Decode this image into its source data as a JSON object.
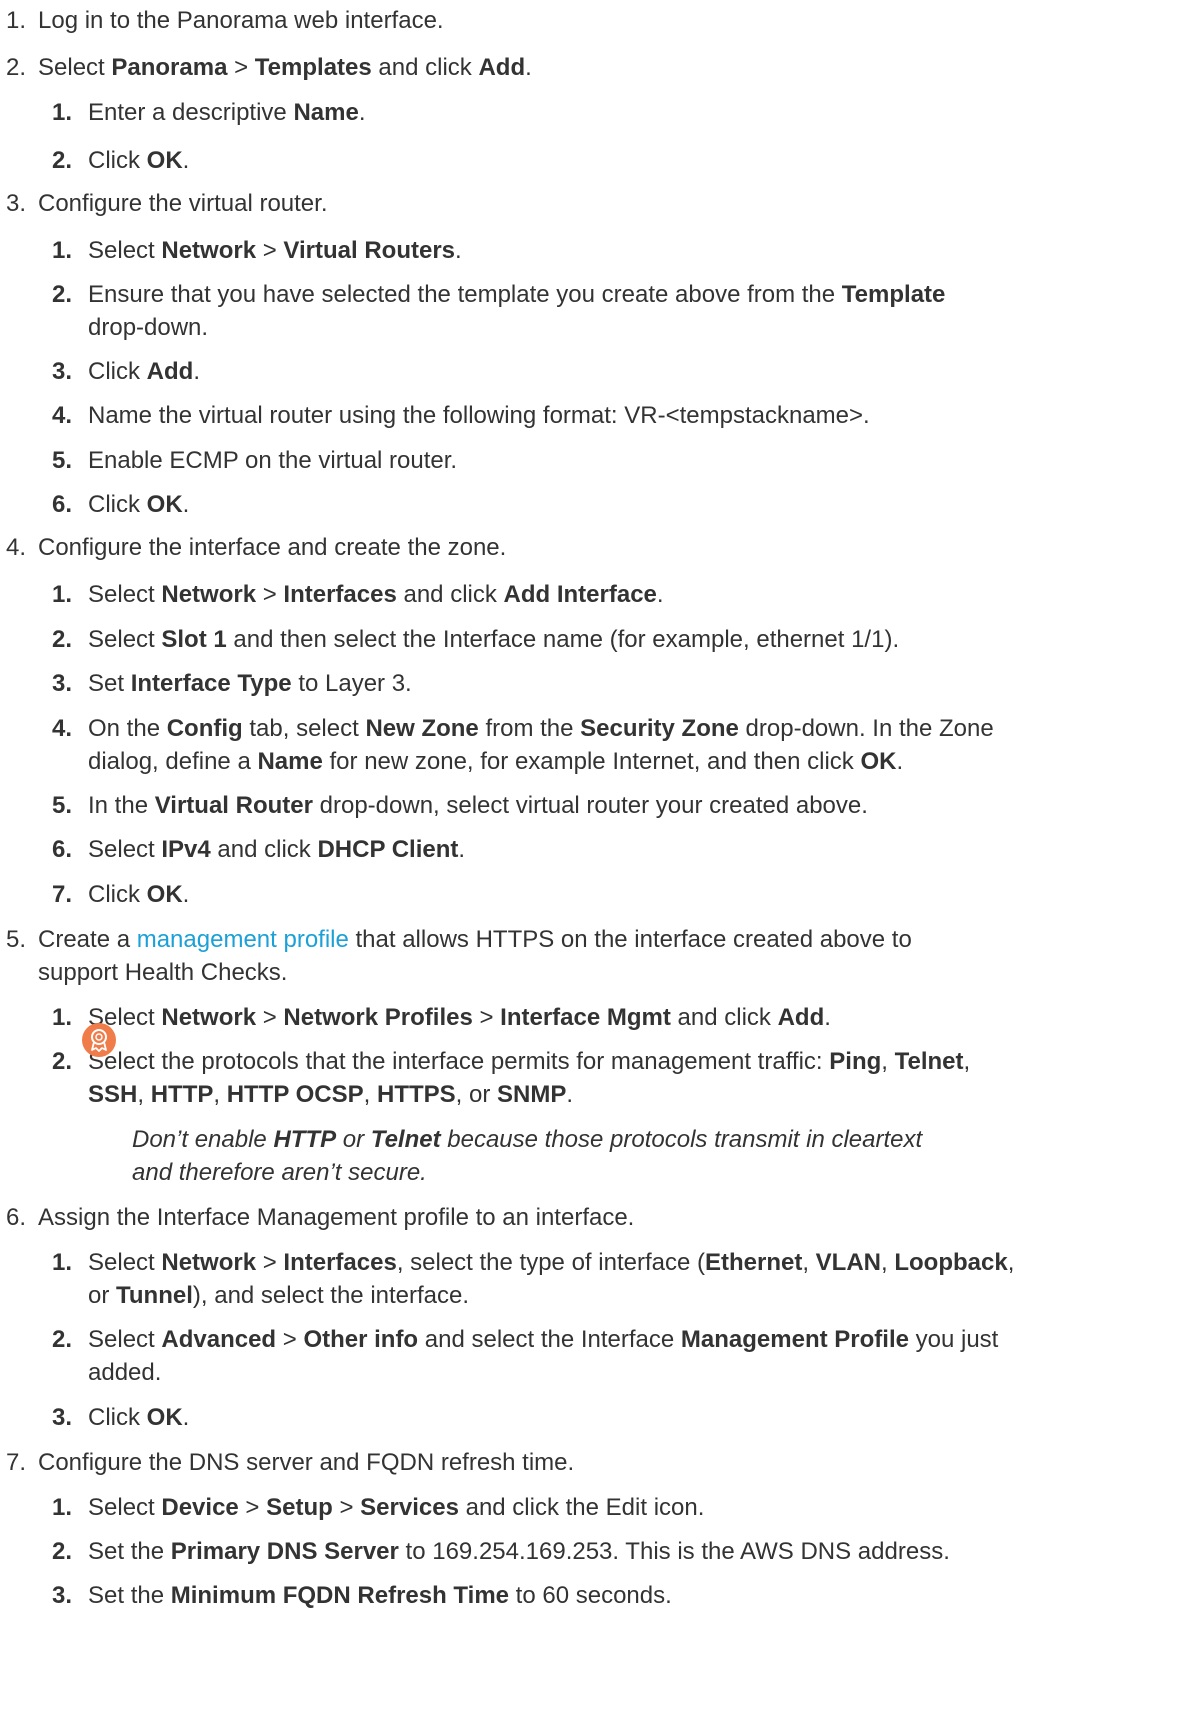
{
  "steps": [
    {
      "num": "1.",
      "lines": [
        [
          "Log in to the Panorama web interface."
        ]
      ],
      "subs": []
    },
    {
      "num": "2.",
      "lines": [
        [
          "Select ",
          {
            "b": "Panorama"
          },
          " > ",
          {
            "b": "Templates"
          },
          " and click ",
          {
            "b": "Add"
          },
          "."
        ]
      ],
      "subs": [
        {
          "num": "1.",
          "lines": [
            [
              "Enter a descriptive ",
              {
                "b": "Name"
              },
              "."
            ]
          ]
        },
        {
          "num": "2.",
          "lines": [
            [
              "Click ",
              {
                "b": "OK"
              },
              "."
            ]
          ]
        }
      ]
    },
    {
      "num": "3.",
      "lines": [
        [
          "Configure the virtual router."
        ]
      ],
      "subs": [
        {
          "num": "1.",
          "lines": [
            [
              "Select ",
              {
                "b": "Network"
              },
              " > ",
              {
                "b": "Virtual Routers"
              },
              "."
            ]
          ]
        },
        {
          "num": "2.",
          "lines": [
            [
              "Ensure that you have selected the template you create above from the ",
              {
                "b": "Template"
              }
            ],
            [
              "drop-down."
            ]
          ]
        },
        {
          "num": "3.",
          "lines": [
            [
              "Click ",
              {
                "b": "Add"
              },
              "."
            ]
          ]
        },
        {
          "num": "4.",
          "lines": [
            [
              "Name the virtual router using the following format: VR-<tempstackname>."
            ]
          ]
        },
        {
          "num": "5.",
          "lines": [
            [
              "Enable ECMP on the virtual router."
            ]
          ]
        },
        {
          "num": "6.",
          "lines": [
            [
              "Click ",
              {
                "b": "OK"
              },
              "."
            ]
          ]
        }
      ]
    },
    {
      "num": "4.",
      "lines": [
        [
          "Configure the interface and create the zone."
        ]
      ],
      "subs": [
        {
          "num": "1.",
          "lines": [
            [
              "Select ",
              {
                "b": "Network"
              },
              " > ",
              {
                "b": "Interfaces"
              },
              " and click ",
              {
                "b": "Add Interface"
              },
              "."
            ]
          ]
        },
        {
          "num": "2.",
          "lines": [
            [
              "Select ",
              {
                "b": "Slot 1"
              },
              " and then select the Interface name (for example, ethernet 1/1)."
            ]
          ]
        },
        {
          "num": "3.",
          "lines": [
            [
              "Set ",
              {
                "b": "Interface Type"
              },
              " to Layer 3."
            ]
          ]
        },
        {
          "num": "4.",
          "lines": [
            [
              "On the ",
              {
                "b": "Config"
              },
              " tab, select ",
              {
                "b": "New Zone"
              },
              " from the ",
              {
                "b": "Security Zone"
              },
              " drop-down. In the Zone"
            ],
            [
              "dialog, define a ",
              {
                "b": "Name"
              },
              " for new zone, for example Internet, and then click ",
              {
                "b": "OK"
              },
              "."
            ]
          ]
        },
        {
          "num": "5.",
          "lines": [
            [
              "In the ",
              {
                "b": "Virtual Router"
              },
              " drop-down, select virtual router your created above."
            ]
          ]
        },
        {
          "num": "6.",
          "lines": [
            [
              "Select ",
              {
                "b": "IPv4"
              },
              " and click ",
              {
                "b": "DHCP Client"
              },
              "."
            ]
          ]
        },
        {
          "num": "7.",
          "lines": [
            [
              "Click ",
              {
                "b": "OK"
              },
              "."
            ]
          ]
        }
      ]
    },
    {
      "num": "5.",
      "lines": [
        [
          "Create a ",
          {
            "link": "management profile"
          },
          " that allows HTTPS on the interface created above to"
        ],
        [
          "support Health Checks."
        ]
      ],
      "subs": [
        {
          "num": "1.",
          "lines": [
            [
              "Select ",
              {
                "b": "Network"
              },
              " > ",
              {
                "b": "Network Profiles"
              },
              " > ",
              {
                "b": "Interface Mgmt"
              },
              " and click ",
              {
                "b": "Add"
              },
              "."
            ]
          ]
        },
        {
          "num": "2.",
          "lines": [
            [
              "Select the protocols that the interface permits for management traffic: ",
              {
                "b": "Ping"
              },
              ", ",
              {
                "b": "Telnet"
              },
              ","
            ],
            [
              {
                "b": "SSH"
              },
              ", ",
              {
                "b": "HTTP"
              },
              ", ",
              {
                "b": "HTTP OCSP"
              },
              ", ",
              {
                "b": "HTTPS"
              },
              ", or ",
              {
                "b": "SNMP"
              },
              "."
            ]
          ]
        }
      ],
      "note": {
        "icon": "best-practice-icon",
        "lines": [
          [
            "Don’t enable ",
            {
              "b": "HTTP"
            },
            " or ",
            {
              "b": "Telnet"
            },
            " because those protocols transmit in cleartext"
          ],
          [
            "and therefore aren’t secure."
          ]
        ]
      }
    },
    {
      "num": "6.",
      "lines": [
        [
          "Assign the Interface Management profile to an interface."
        ]
      ],
      "subs": [
        {
          "num": "1.",
          "lines": [
            [
              "Select ",
              {
                "b": "Network"
              },
              " > ",
              {
                "b": "Interfaces"
              },
              ", select the type of interface (",
              {
                "b": "Ethernet"
              },
              ", ",
              {
                "b": "VLAN"
              },
              ", ",
              {
                "b": "Loopback"
              },
              ","
            ],
            [
              "or ",
              {
                "b": "Tunnel"
              },
              "), and select the interface."
            ]
          ]
        },
        {
          "num": "2.",
          "lines": [
            [
              "Select ",
              {
                "b": "Advanced"
              },
              " > ",
              {
                "b": "Other info"
              },
              " and select the Interface ",
              {
                "b": "Management Profile"
              },
              " you just"
            ],
            [
              "added."
            ]
          ]
        },
        {
          "num": "3.",
          "lines": [
            [
              "Click ",
              {
                "b": "OK"
              },
              "."
            ]
          ]
        }
      ]
    },
    {
      "num": "7.",
      "lines": [
        [
          "Configure the DNS server and FQDN refresh time."
        ]
      ],
      "subs": [
        {
          "num": "1.",
          "lines": [
            [
              "Select ",
              {
                "b": "Device"
              },
              " > ",
              {
                "b": "Setup"
              },
              " > ",
              {
                "b": "Services"
              },
              " and click the Edit icon."
            ]
          ]
        },
        {
          "num": "2.",
          "lines": [
            [
              "Set the ",
              {
                "b": "Primary DNS Server"
              },
              " to 169.254.169.253. This is the AWS DNS address."
            ]
          ]
        },
        {
          "num": "3.",
          "lines": [
            [
              "Set the ",
              {
                "b": "Minimum FQDN Refresh Time"
              },
              " to 60 seconds."
            ]
          ]
        }
      ]
    }
  ],
  "colors": {
    "text": "#333333",
    "link": "#1ba0d7",
    "note_icon": "#f07c4a"
  }
}
